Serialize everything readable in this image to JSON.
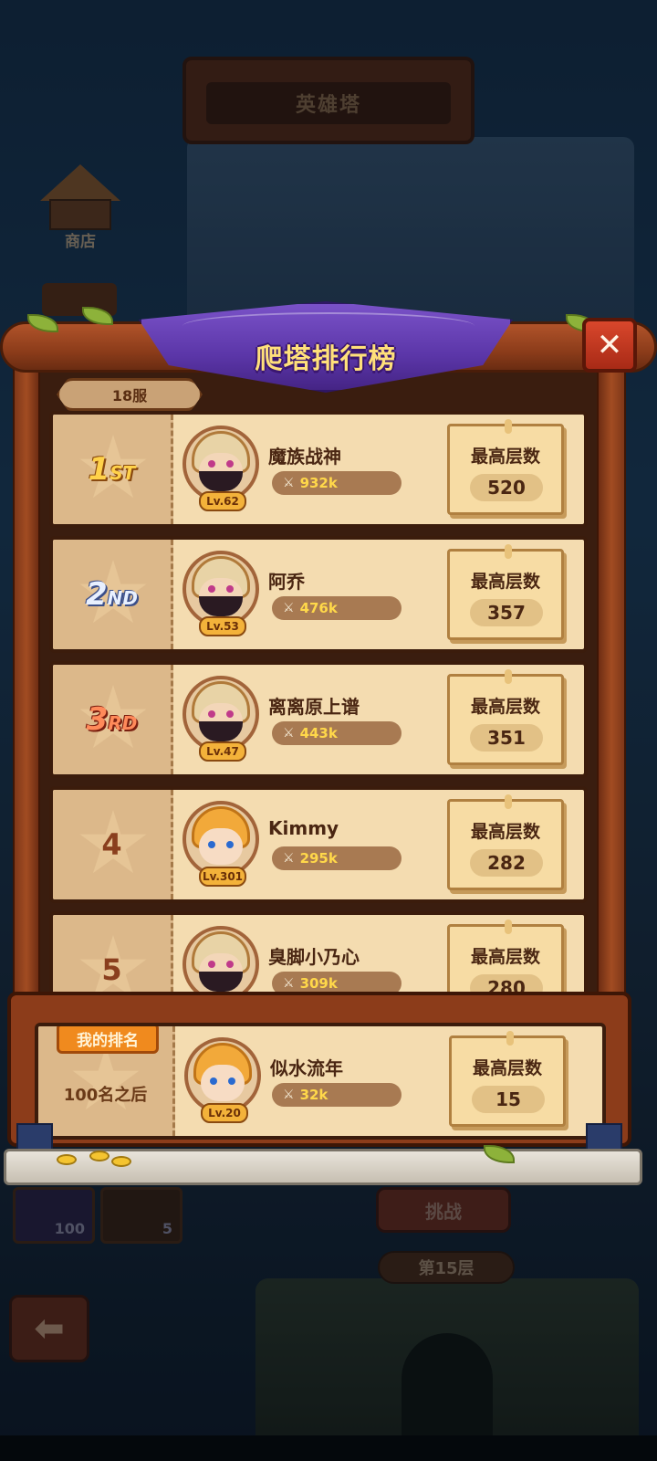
{
  "background": {
    "tower_title": "英雄塔",
    "shop_label": "商店",
    "slot_counts": [
      "100",
      "5"
    ],
    "challenge_label": "挑战",
    "floor_tag": "第15层"
  },
  "leaderboard": {
    "title": "爬塔排行榜",
    "server": "18服",
    "floor_label": "最高层数",
    "entries": [
      {
        "rank_big": "1",
        "rank_suffix": "ST",
        "name": "魔族战神",
        "level": "Lv.62",
        "power": "932k",
        "floor": "520",
        "avatar": "masked-warrior"
      },
      {
        "rank_big": "2",
        "rank_suffix": "ND",
        "name": "阿乔",
        "level": "Lv.53",
        "power": "476k",
        "floor": "357",
        "avatar": "masked-warrior"
      },
      {
        "rank_big": "3",
        "rank_suffix": "RD",
        "name": "离离原上谱",
        "level": "Lv.47",
        "power": "443k",
        "floor": "351",
        "avatar": "masked-warrior"
      },
      {
        "rank_big": "4",
        "rank_suffix": "",
        "name": "Kimmy",
        "level": "Lv.301",
        "power": "295k",
        "floor": "282",
        "avatar": "blonde-hero"
      },
      {
        "rank_big": "5",
        "rank_suffix": "",
        "name": "臭脚小乃心",
        "level": "",
        "power": "309k",
        "floor": "280",
        "avatar": "masked-warrior"
      }
    ],
    "my_rank": {
      "tag": "我的排名",
      "rank_text": "100名之后",
      "name": "似水流年",
      "level": "Lv.20",
      "power": "32k",
      "floor": "15",
      "avatar": "blonde-hero"
    }
  },
  "colors": {
    "banner_purple": "#5b36a8",
    "title_gold": "#ffe07a",
    "card_bg": "#f4dcb0",
    "close_red": "#d9472c"
  },
  "icons": [
    "close-icon",
    "sword-icon",
    "back-arrow-icon",
    "shop-icon"
  ]
}
